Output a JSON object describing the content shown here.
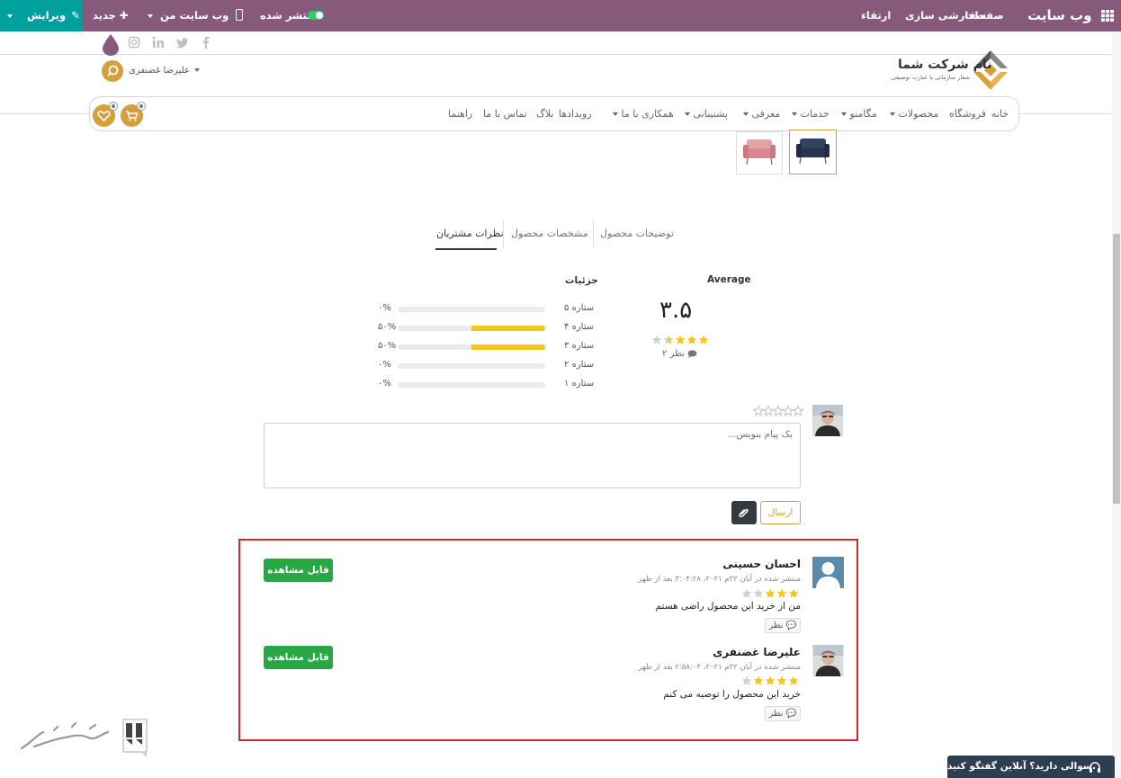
{
  "topbar": {
    "app_title": "وب سایت",
    "menu_pages": "صفحات",
    "menu_customize": "سفارشی سازی",
    "menu_upgrade": "ارتقاء",
    "published_label": "منتشر شده",
    "my_website_label": "وب سایت من",
    "new_label": "جدید",
    "edit_label": "ویرایش",
    "colors": {
      "bar": "#875a7b",
      "edit_bg": "#00a09d"
    }
  },
  "header": {
    "company_name": "نام شرکت شما",
    "company_slogan": "شعار سازمانی یا عبارت توصیفی",
    "user_name": "علیرضا غضنفری",
    "social_icons": [
      "facebook-icon",
      "twitter-icon",
      "linkedin-icon",
      "instagram-icon"
    ],
    "cart_count": "۰",
    "wishlist_count": "۰"
  },
  "nav": {
    "items": [
      {
        "label": "خانه"
      },
      {
        "label": "فروشگاه"
      },
      {
        "label": "محصولات"
      },
      {
        "label": "مگامنو"
      },
      {
        "label": "خدمات"
      },
      {
        "label": "معرفی"
      },
      {
        "label": "پشتیبانی"
      },
      {
        "label": "همکاری با ما"
      },
      {
        "label": "رویدادها"
      },
      {
        "label": "بلاگ"
      },
      {
        "label": "تماس با ما"
      },
      {
        "label": "راهنما"
      }
    ]
  },
  "tabs": {
    "description": "توضیحات محصول",
    "specs": "مشخصات محصول",
    "reviews": "نظرات مشتریان"
  },
  "rating": {
    "average_label": "Average",
    "average_value": "۳.۵",
    "average_numeric": 3.5,
    "review_count": "۲ نظر",
    "details_label": "جزئیات",
    "rows": [
      {
        "label": "۵ ستاره",
        "percent_text": "۰%",
        "percent": 0
      },
      {
        "label": "۴ ستاره",
        "percent_text": "۵۰%",
        "percent": 50
      },
      {
        "label": "۳ ستاره",
        "percent_text": "۵۰%",
        "percent": 50
      },
      {
        "label": "۲ ستاره",
        "percent_text": "۰%",
        "percent": 0
      },
      {
        "label": "۱ ستاره",
        "percent_text": "۰%",
        "percent": 0
      }
    ],
    "star_color": "#f5c518"
  },
  "composer": {
    "placeholder": "یک پیام بنویس...",
    "send_label": "ارسال"
  },
  "reviews": [
    {
      "author": "احسان حسینی",
      "meta": "منتشر شده در آبان ۲۲م ۲۰۲۱، ۳:۰۴:۲۸ بعد از ظهر",
      "stars": 3,
      "text": "من از خرید این محصول راضی هستم",
      "reply_label": "نظر",
      "status": "قابل مشاهده"
    },
    {
      "author": "علیرضا غضنفری",
      "meta": "منتشر شده در آبان ۲۲م ۲۰۲۱، ۲:۵۸:۰۴ بعد از ظهر",
      "stars": 4,
      "text": "خرید این محصول را توصیه می کنم",
      "reply_label": "نظر",
      "status": "قابل مشاهده"
    }
  ],
  "chat": {
    "text": "سوالی دارید؟ آنلاین گفتگو کنید."
  }
}
